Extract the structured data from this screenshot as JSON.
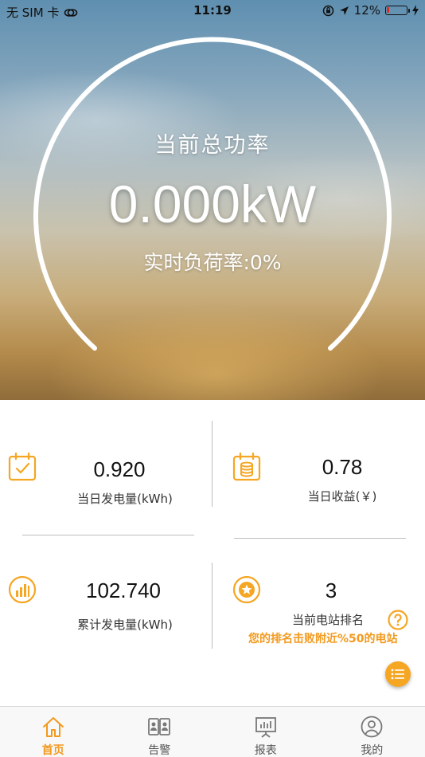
{
  "status_bar": {
    "carrier": "无 SIM 卡",
    "time": "11:19",
    "battery_percent": "12%",
    "battery_level": 0.12,
    "icons": [
      "wifi-link-icon",
      "orientation-lock-icon",
      "location-arrow-icon",
      "battery-icon",
      "charging-bolt-icon"
    ]
  },
  "hero": {
    "title": "当前总功率",
    "power_value": "0.000kW",
    "load_rate": "实时负荷率:0%",
    "load_rate_fraction": 0.0
  },
  "stats": {
    "daily_generation": {
      "value": "0.920",
      "label": "当日发电量(kWh)",
      "icon": "calendar-check-icon"
    },
    "daily_revenue": {
      "value": "0.78",
      "label": "当日收益(￥)",
      "icon": "coin-stack-icon"
    },
    "total_generation": {
      "value": "102.740",
      "label": "累计发电量(kWh)",
      "icon": "bar-chart-icon"
    },
    "station_rank": {
      "value": "3",
      "label": "当前电站排名",
      "note": "您的排名击败附近%50的电站",
      "icon": "medal-icon",
      "help_icon": "question-icon"
    }
  },
  "fab": {
    "icon": "list-menu-icon"
  },
  "tabs": [
    {
      "label": "首页",
      "icon": "home-icon",
      "active": true
    },
    {
      "label": "告警",
      "icon": "alarm-cards-icon",
      "active": false
    },
    {
      "label": "报表",
      "icon": "report-board-icon",
      "active": false
    },
    {
      "label": "我的",
      "icon": "user-icon",
      "active": false
    }
  ],
  "colors": {
    "accent": "#f29a1f",
    "fab": "#f5a623",
    "battery_low": "#e0291c",
    "divider": "#bdbdbd"
  }
}
